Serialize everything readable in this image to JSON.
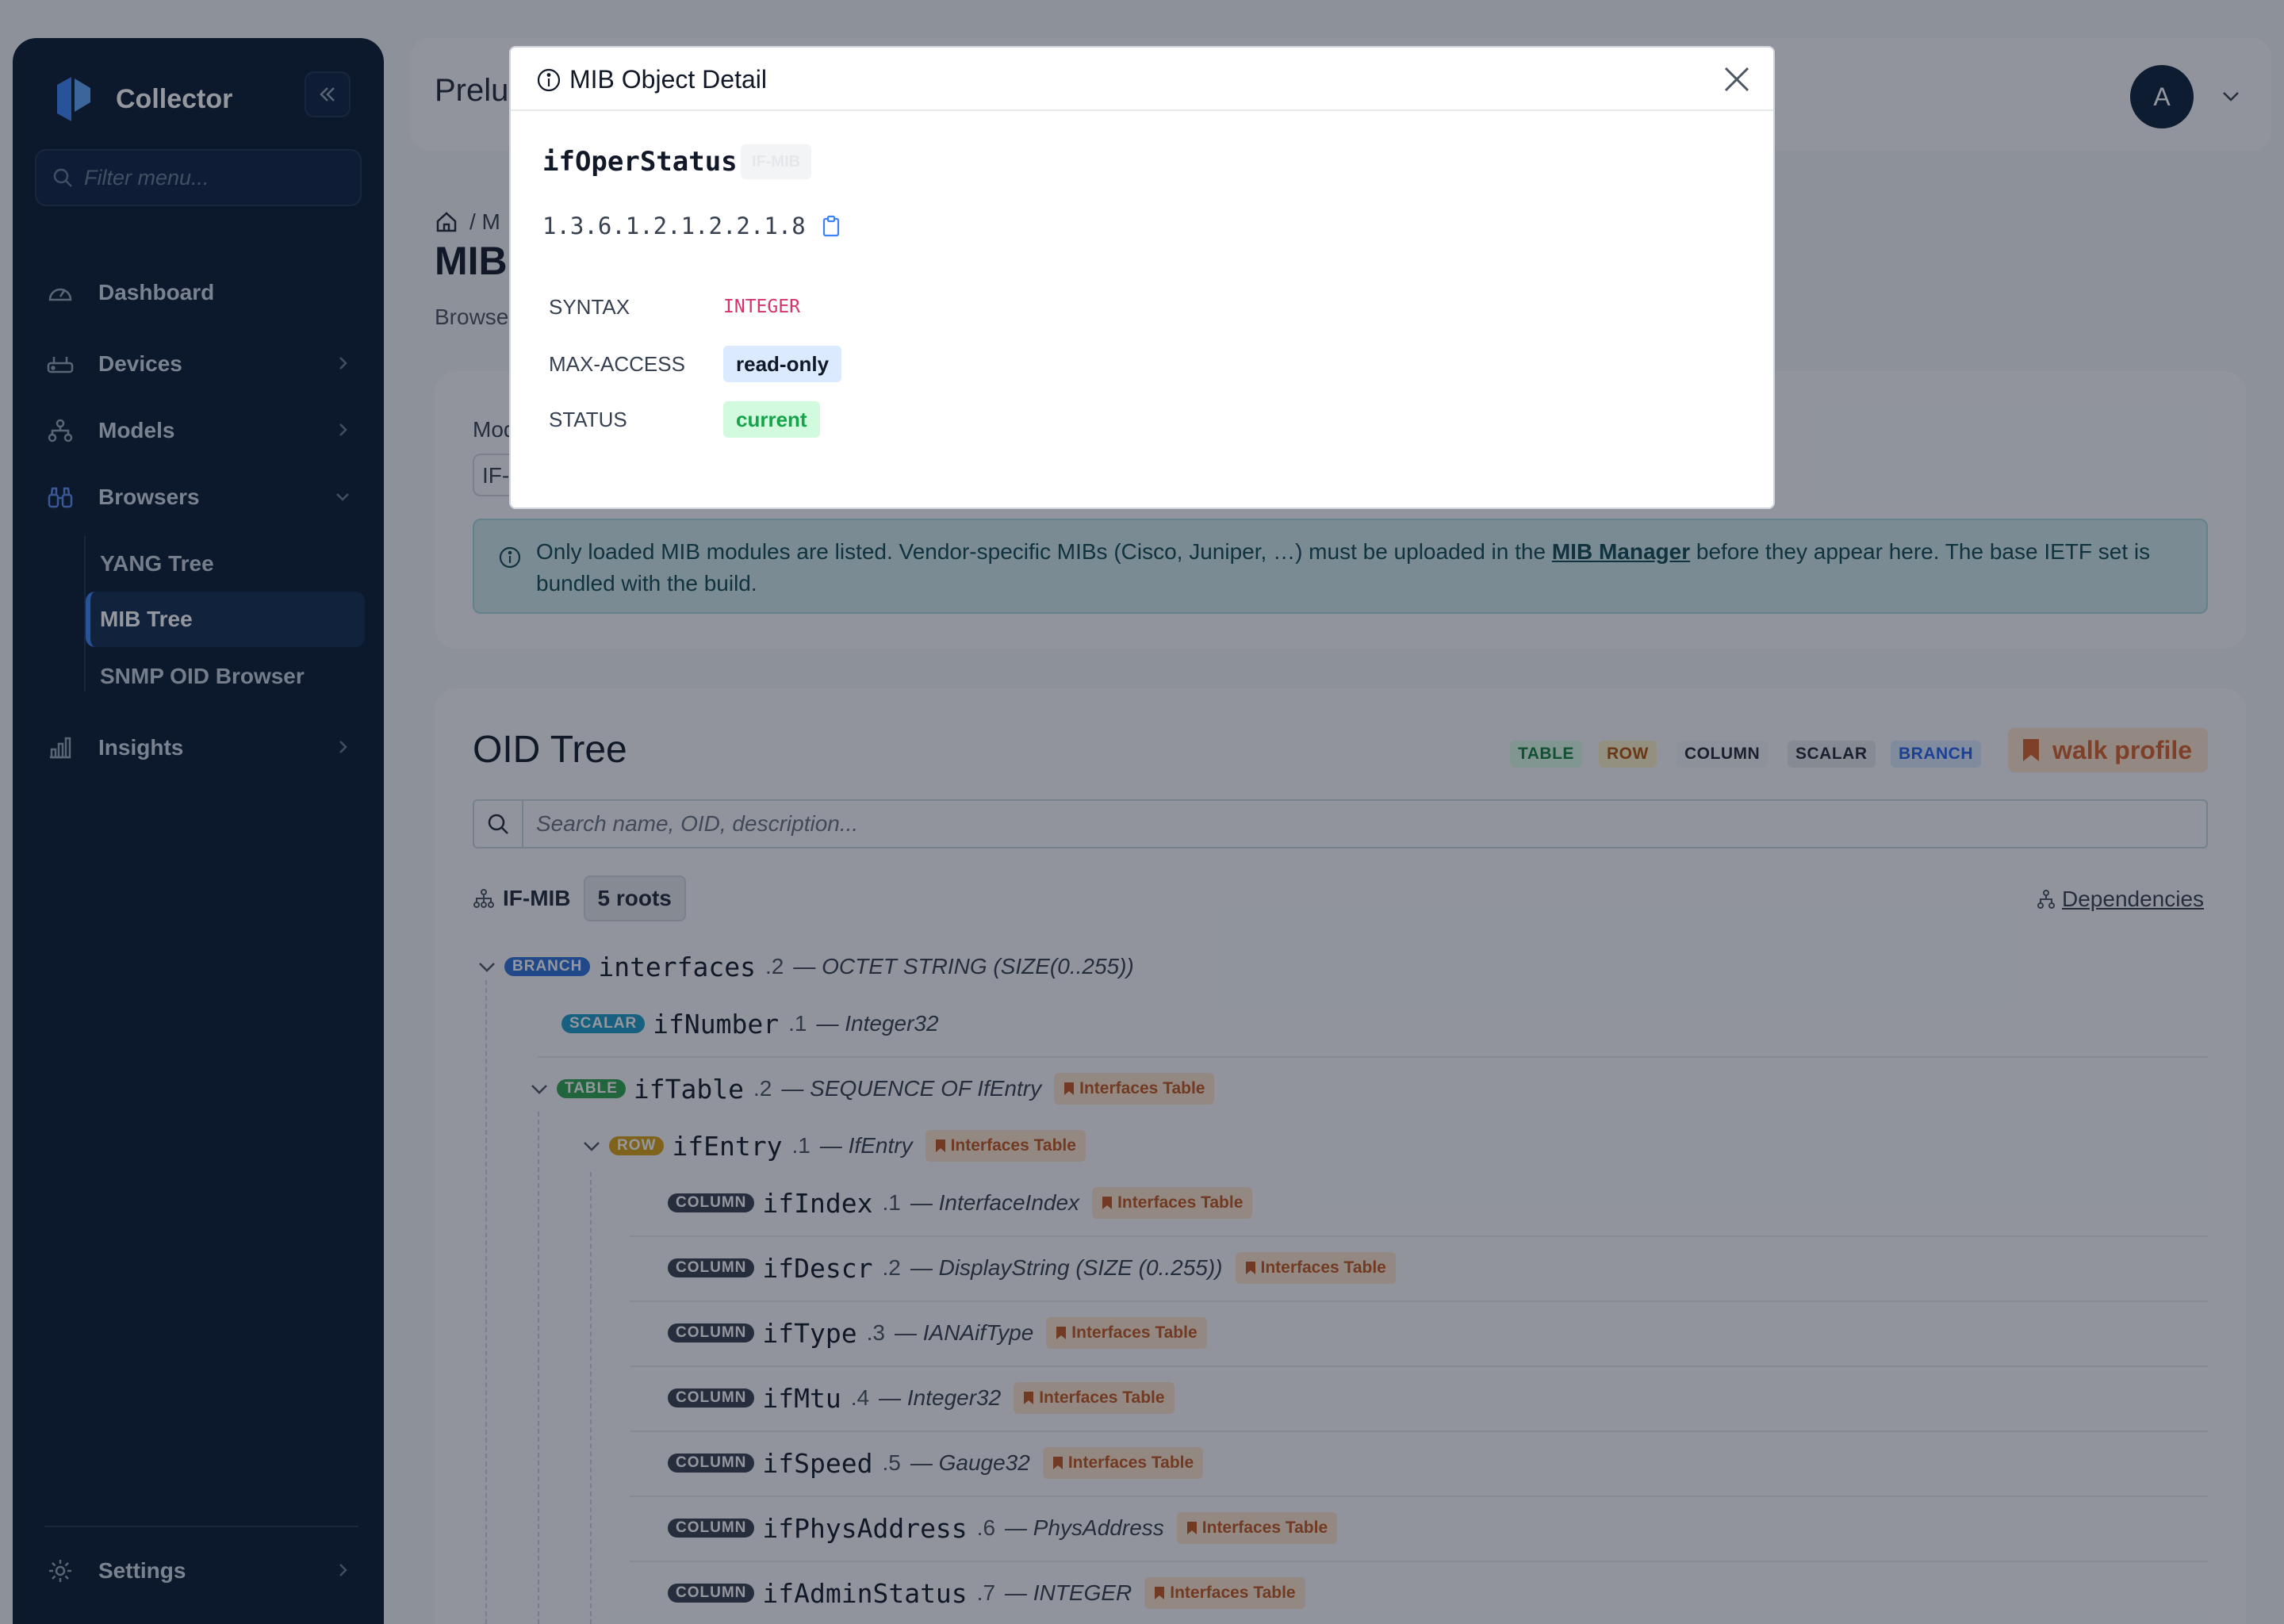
{
  "sidebar": {
    "brand": "Collector",
    "filter_placeholder": "Filter menu...",
    "items": [
      {
        "label": "Dashboard"
      },
      {
        "label": "Devices"
      },
      {
        "label": "Models"
      },
      {
        "label": "Browsers"
      },
      {
        "label": "Insights"
      }
    ],
    "browsers_sub": [
      {
        "label": "YANG Tree"
      },
      {
        "label": "MIB Tree"
      },
      {
        "label": "SNMP OID Browser"
      }
    ],
    "settings": "Settings",
    "colors": {
      "bg": "#081a30",
      "active": "#112b4d",
      "accent": "#3b82f6"
    }
  },
  "topbar": {
    "title": "Prelud",
    "avatar_letter": "A"
  },
  "page": {
    "breadcrumb": "/  M",
    "title": "MIB",
    "subtitle": "Browse"
  },
  "module_card": {
    "label": "Mod",
    "select_value": "IF-",
    "alert_text_1": "Only loaded MIB modules are listed. Vendor-specific MIBs (Cisco, Juniper, …) must be uploaded in the ",
    "alert_link": "MIB Manager",
    "alert_text_2": " before they appear here. The base IETF set is bundled with the build."
  },
  "tree": {
    "title": "OID Tree",
    "legend": {
      "table": "TABLE",
      "row": "ROW",
      "column": "COLUMN",
      "scalar": "SCALAR",
      "branch": "BRANCH"
    },
    "walk_profile": "walk profile",
    "search_placeholder": "Search name, OID, description...",
    "module": "IF-MIB",
    "roots": "5 roots",
    "dependencies": "Dependencies",
    "rows": [
      {
        "kind": "BRANCH",
        "name": "interfaces",
        "suffix": ".2",
        "type": "— OCTET STRING (SIZE(0..255))"
      },
      {
        "kind": "SCALAR",
        "name": "ifNumber",
        "suffix": ".1",
        "type": "— Integer32"
      },
      {
        "kind": "TABLE",
        "name": "ifTable",
        "suffix": ".2",
        "type": "— SEQUENCE OF IfEntry",
        "tag": "Interfaces Table"
      },
      {
        "kind": "ROW",
        "name": "ifEntry",
        "suffix": ".1",
        "type": "— IfEntry",
        "tag": "Interfaces Table"
      },
      {
        "kind": "COLUMN",
        "name": "ifIndex",
        "suffix": ".1",
        "type": "— InterfaceIndex",
        "tag": "Interfaces Table"
      },
      {
        "kind": "COLUMN",
        "name": "ifDescr",
        "suffix": ".2",
        "type": "— DisplayString (SIZE (0..255))",
        "tag": "Interfaces Table"
      },
      {
        "kind": "COLUMN",
        "name": "ifType",
        "suffix": ".3",
        "type": "— IANAifType",
        "tag": "Interfaces Table"
      },
      {
        "kind": "COLUMN",
        "name": "ifMtu",
        "suffix": ".4",
        "type": "— Integer32",
        "tag": "Interfaces Table"
      },
      {
        "kind": "COLUMN",
        "name": "ifSpeed",
        "suffix": ".5",
        "type": "— Gauge32",
        "tag": "Interfaces Table"
      },
      {
        "kind": "COLUMN",
        "name": "ifPhysAddress",
        "suffix": ".6",
        "type": "— PhysAddress",
        "tag": "Interfaces Table"
      },
      {
        "kind": "COLUMN",
        "name": "ifAdminStatus",
        "suffix": ".7",
        "type": "— INTEGER",
        "tag": "Interfaces Table"
      }
    ]
  },
  "modal": {
    "title": "MIB Object Detail",
    "object_name": "ifOperStatus",
    "mib": "IF-MIB",
    "oid": "1.3.6.1.2.1.2.2.1.8",
    "props": {
      "syntax_label": "SYNTAX",
      "syntax_value": "INTEGER",
      "access_label": "MAX-ACCESS",
      "access_value": "read-only",
      "status_label": "STATUS",
      "status_value": "current"
    }
  }
}
